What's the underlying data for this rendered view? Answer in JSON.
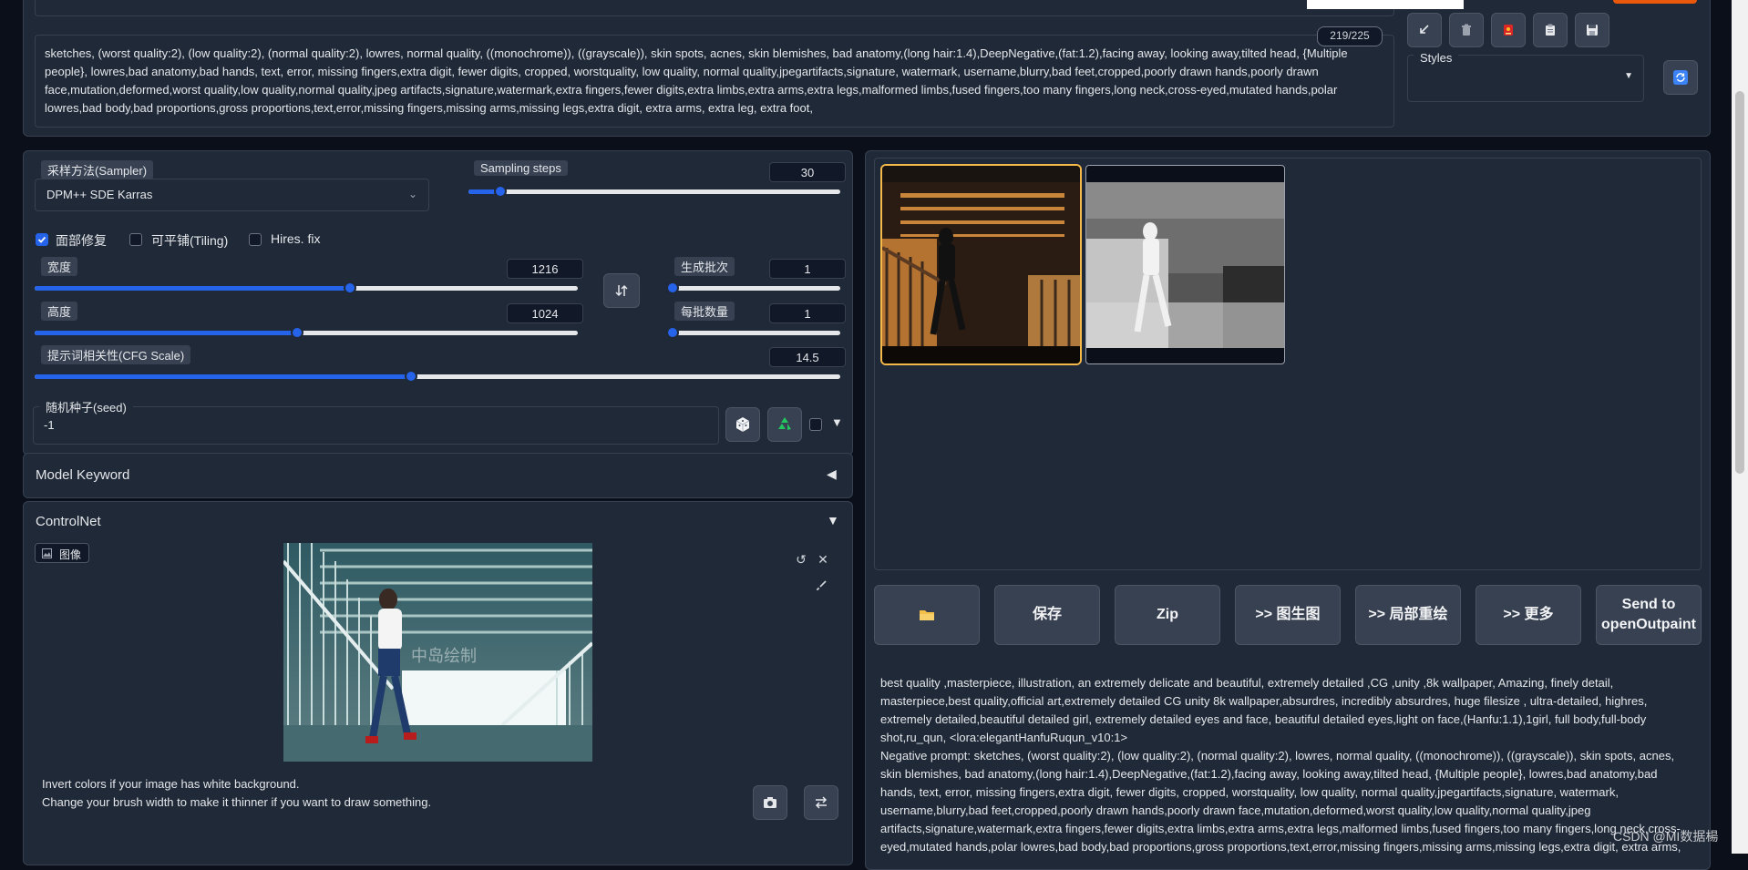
{
  "prompt": {
    "counter": "219/225",
    "negative_text": "sketches, (worst quality:2), (low quality:2), (normal quality:2), lowres, normal quality, ((monochrome)), ((grayscale)), skin spots, acnes, skin blemishes, bad anatomy,(long hair:1.4),DeepNegative,(fat:1.2),facing away, looking away,tilted head, {Multiple people}, lowres,bad anatomy,bad hands, text, error, missing fingers,extra digit, fewer digits, cropped, worstquality, low quality, normal quality,jpegartifacts,signature, watermark, username,blurry,bad feet,cropped,poorly drawn hands,poorly drawn face,mutation,deformed,worst quality,low quality,normal quality,jpeg artifacts,signature,watermark,extra fingers,fewer digits,extra limbs,extra arms,extra legs,malformed limbs,fused fingers,too many fingers,long neck,cross-eyed,mutated hands,polar lowres,bad body,bad proportions,gross proportions,text,error,missing fingers,missing arms,missing legs,extra digit, extra arms, extra leg, extra foot,"
  },
  "toolbar_icons": [
    "arrow-icon",
    "trash-icon",
    "red-card-icon",
    "clipboard-icon",
    "save-icon"
  ],
  "styles": {
    "label": "Styles",
    "value": ""
  },
  "sampler": {
    "label": "采样方法(Sampler)",
    "value": "DPM++ SDE Karras"
  },
  "steps": {
    "label": "Sampling steps",
    "value": "30",
    "fraction": 0.086
  },
  "checkboxes": [
    {
      "label": "面部修复",
      "checked": true
    },
    {
      "label": "可平铺(Tiling)",
      "checked": false
    },
    {
      "label": "Hires. fix",
      "checked": false
    }
  ],
  "width": {
    "label": "宽度",
    "value": "1216",
    "fraction": 0.58
  },
  "height": {
    "label": "高度",
    "value": "1024",
    "fraction": 0.484
  },
  "batch_count": {
    "label": "生成批次",
    "value": "1",
    "fraction": 0.0
  },
  "batch_size": {
    "label": "每批数量",
    "value": "1",
    "fraction": 0.0
  },
  "cfg": {
    "label": "提示词相关性(CFG Scale)",
    "value": "14.5",
    "fraction": 0.467
  },
  "seed": {
    "label": "随机种子(seed)",
    "value": "-1"
  },
  "model_keyword": {
    "label": "Model Keyword",
    "arrow": "◀"
  },
  "controlnet": {
    "label": "ControlNet",
    "arrow": "▼",
    "image_tab": "图像",
    "watermark": "中岛绘制",
    "hint1": "Invert colors if your image has white background.",
    "hint2": "Change your brush width to make it thinner if you want to draw something."
  },
  "actions": {
    "save": "保存",
    "zip": "Zip",
    "img2img": ">> 图生图",
    "inpaint": ">> 局部重绘",
    "more": ">> 更多",
    "send": "Send to openOutpaint"
  },
  "output_info": {
    "positive": "best quality ,masterpiece, illustration, an extremely delicate and beautiful, extremely detailed ,CG ,unity ,8k wallpaper, Amazing, finely detail, masterpiece,best quality,official art,extremely detailed CG unity 8k wallpaper,absurdres, incredibly absurdres, huge filesize , ultra-detailed, highres, extremely detailed,beautiful detailed girl, extremely detailed eyes and face, beautiful detailed eyes,light on face,(Hanfu:1.1),1girl, full body,full-body shot,ru_qun, <lora:elegantHanfuRuqun_v10:1>",
    "negative": "Negative prompt: sketches, (worst quality:2), (low quality:2), (normal quality:2), lowres, normal quality, ((monochrome)), ((grayscale)), skin spots, acnes, skin blemishes, bad anatomy,(long hair:1.4),DeepNegative,(fat:1.2),facing away, looking away,tilted head, {Multiple people}, lowres,bad anatomy,bad hands, text, error, missing fingers,extra digit, fewer digits, cropped, worstquality, low quality, normal quality,jpegartifacts,signature, watermark, username,blurry,bad feet,cropped,poorly drawn hands,poorly drawn face,mutation,deformed,worst quality,low quality,normal quality,jpeg artifacts,signature,watermark,extra fingers,fewer digits,extra limbs,extra arms,extra legs,malformed limbs,fused fingers,too many fingers,long neck,cross-eyed,mutated hands,polar lowres,bad body,bad proportions,gross proportions,text,error,missing fingers,missing arms,missing legs,extra digit, extra arms, extra leg, extra foot,"
  },
  "watermark_corner": "CSDN @MI数据楊",
  "colors": {
    "accent": "#2563eb",
    "selected_border": "#f5b94a",
    "background": "#0b0f19",
    "panel": "#1f2937"
  }
}
